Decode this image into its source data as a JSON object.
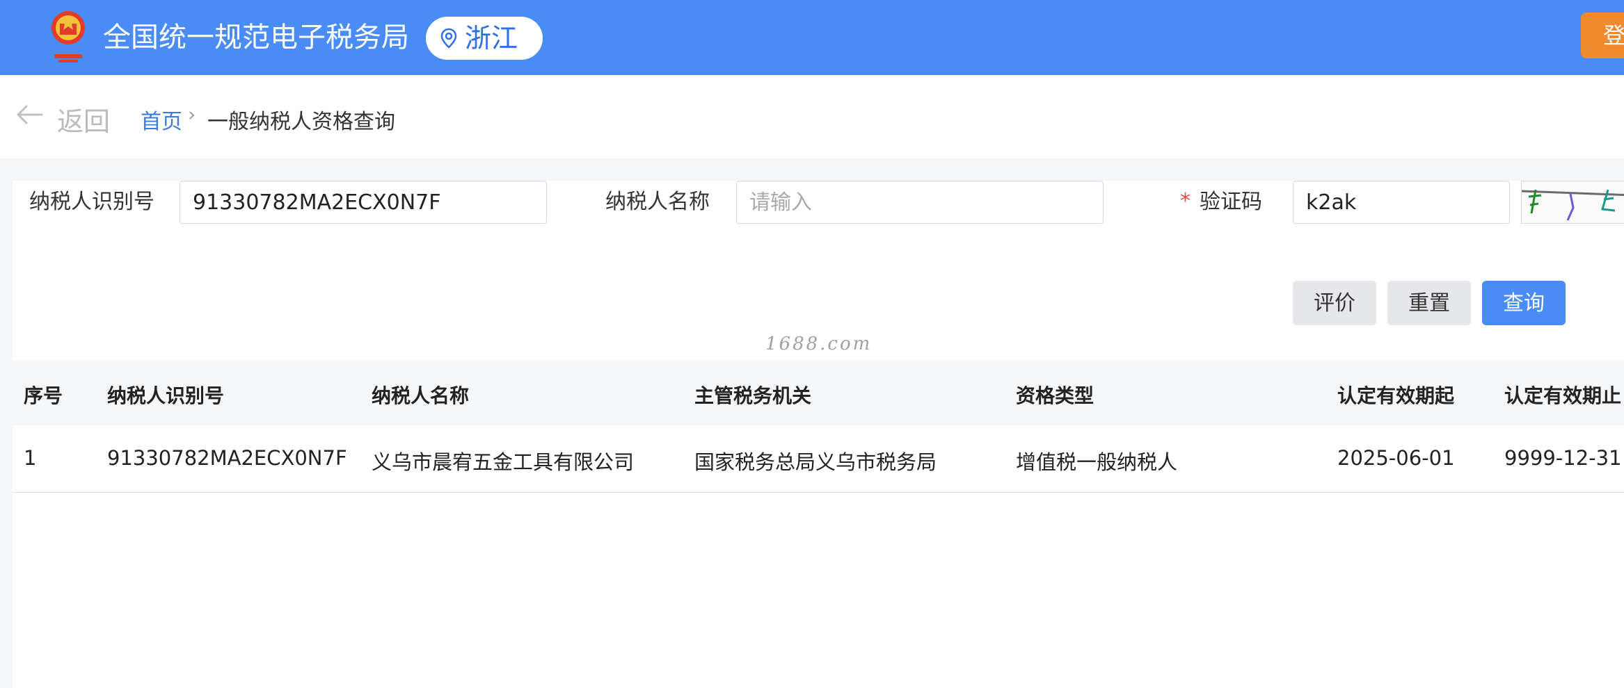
{
  "header": {
    "site_title": "全国统一规范电子税务局",
    "region": "浙江",
    "login_label": "登录"
  },
  "nav": {
    "back_label": "返回",
    "breadcrumb_home": "首页",
    "breadcrumb_separator": "›",
    "breadcrumb_current": "一般纳税人资格查询"
  },
  "form": {
    "taxpayer_id_label": "纳税人识别号",
    "taxpayer_id_value": "91330782MA2ECX0N7F",
    "taxpayer_name_label": "纳税人名称",
    "taxpayer_name_placeholder": "请输入",
    "captcha_required_mark": "*",
    "captcha_label": "验证码",
    "captcha_value": "k2ak"
  },
  "buttons": {
    "evaluate": "评价",
    "reset": "重置",
    "query": "查询"
  },
  "watermark": "1688.com",
  "table": {
    "headers": [
      "序号",
      "纳税人识别号",
      "纳税人名称",
      "主管税务机关",
      "资格类型",
      "认定有效期起",
      "认定有效期止"
    ],
    "rows": [
      [
        "1",
        "91330782MA2ECX0N7F",
        "义乌市晨宥五金工具有限公司",
        "国家税务总局义乌市税务局",
        "增值税一般纳税人",
        "2025-06-01",
        "9999-12-31"
      ]
    ]
  },
  "colors": {
    "header_bg": "#4a8cf6",
    "primary_button": "#4a8cf6",
    "login_button": "#f08a2c",
    "required": "#e84a4a"
  }
}
